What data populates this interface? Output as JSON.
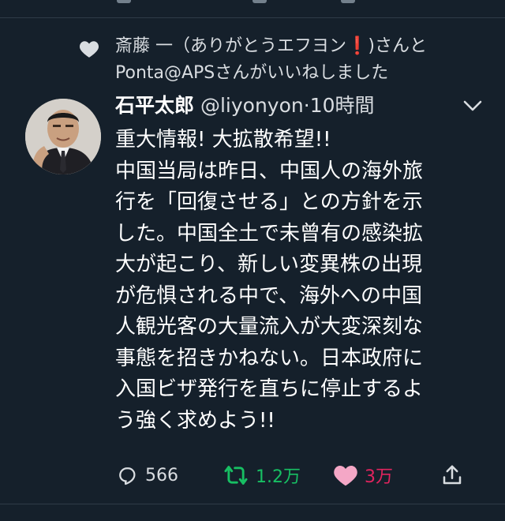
{
  "social_context": {
    "text_before": "斎藤 一（ありがとうエフヨン",
    "emoji": "❗",
    "text_after": ")さんとPonta@APSさんがいいねしました"
  },
  "tweet": {
    "author_name": "石平太郎",
    "handle": "@liyonyon",
    "separator": "·",
    "time": "10時間",
    "lines": [
      "重大情報! 大拡散希望!!",
      "中国当局は昨日、中国人の海外旅",
      "行を「回復させる」との方針を示",
      "した。中国全土で未曾有の感染拡",
      "大が起こり、新しい変異株の出現",
      "が危惧される中で、海外への中国",
      "人観光客の大量流入が大変深刻な",
      "事態を招きかねない。日本政府に",
      "入国ビザ発行を直ちに停止するよ",
      "う強く求めよう!!"
    ]
  },
  "actions": {
    "reply_count": "566",
    "retweet_count": "1.2万",
    "like_count": "3万"
  },
  "colors": {
    "background": "#15202b",
    "retweet_active": "#17bf63",
    "like_active": "#e0245e"
  }
}
